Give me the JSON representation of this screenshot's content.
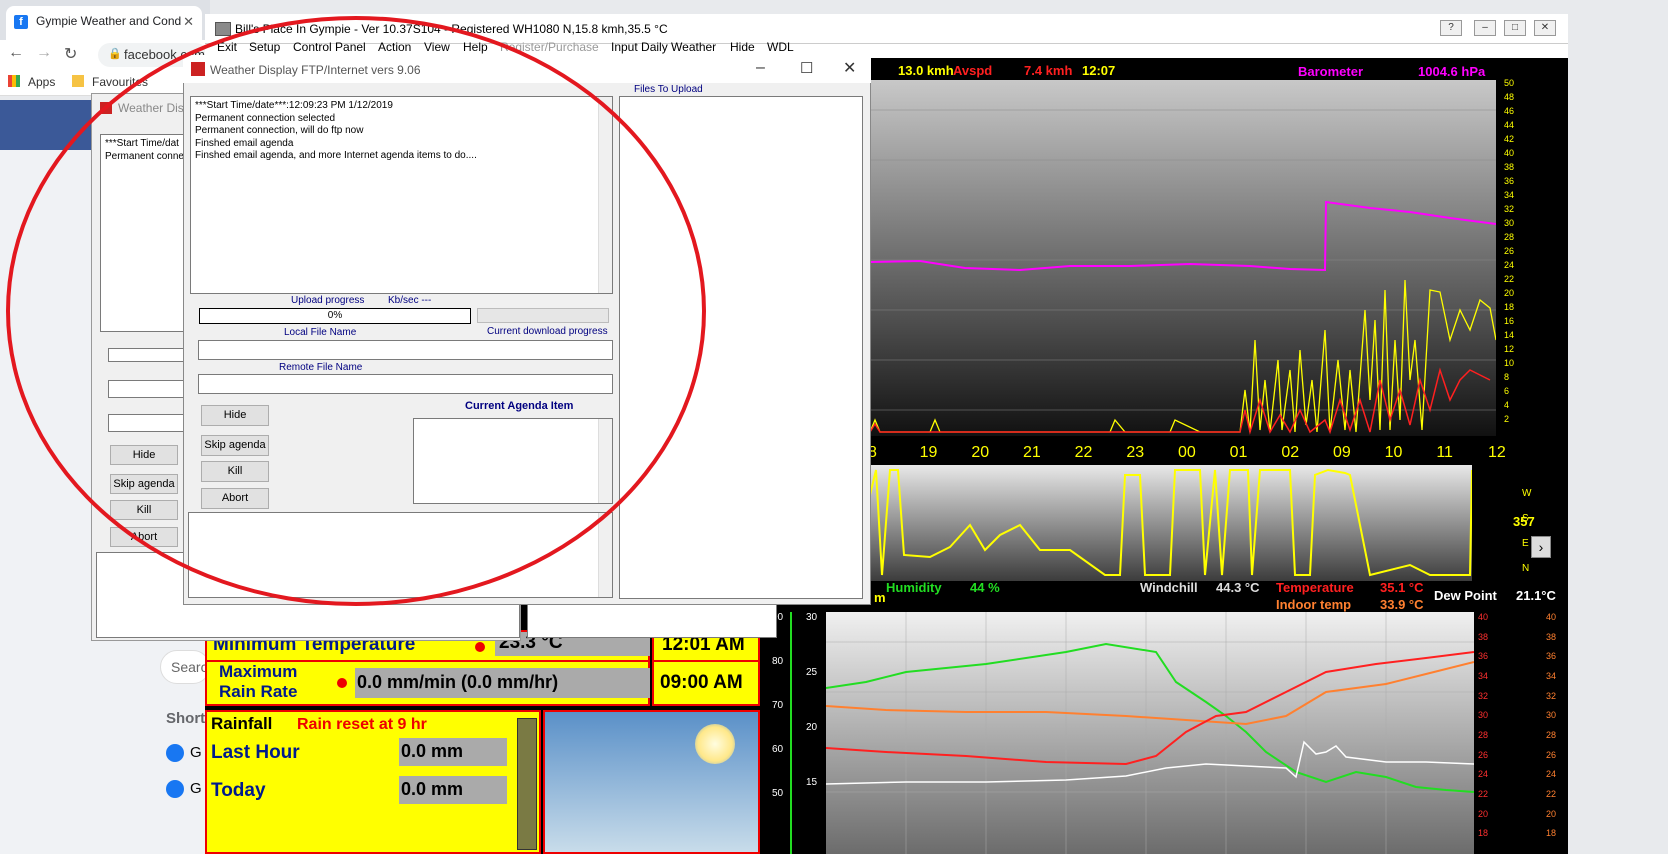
{
  "browser": {
    "tab_title": "Gympie Weather and Cond",
    "tab_favicon": "f",
    "address": "facebook.com",
    "bookmarks": [
      "Apps",
      "Favourites"
    ],
    "fb_search_placeholder": "Searc",
    "shortcuts_label": "Short",
    "shortcut_items": [
      "G",
      "G"
    ]
  },
  "weather_display": {
    "title": "Bill's Place In Gympie - Ver 10.37S104 - Registered    WH1080   N,15.8 kmh,35.5 °C",
    "menu": [
      "Exit",
      "Setup",
      "Control Panel",
      "Action",
      "View",
      "Help",
      "Register/Purchase",
      "Input Daily Weather",
      "Hide",
      "WDL"
    ],
    "header": {
      "wind_value": "13.0 kmh",
      "avspd_label": "Avspd",
      "avspd_value": "7.4 kmh",
      "time": "12:07",
      "barometer_label": "Barometer",
      "barometer_value": "1004.6 hPa"
    },
    "top_y_ticks": [
      "50",
      "48",
      "46",
      "44",
      "42",
      "40",
      "38",
      "36",
      "34",
      "32",
      "30",
      "28",
      "26",
      "24",
      "22",
      "20",
      "18",
      "16",
      "14",
      "12",
      "10",
      "8",
      "6",
      "4",
      "2"
    ],
    "top_x_ticks": [
      "8",
      "19",
      "20",
      "21",
      "22",
      "23",
      "00",
      "01",
      "02",
      "09",
      "10",
      "11",
      "12"
    ],
    "direction_labels": [
      "W",
      "S",
      "E",
      "N"
    ],
    "direction_value": "357",
    "sensor_row": {
      "m_label": "m",
      "humidity_label": "Humidity",
      "humidity_value": "44 %",
      "windchill_label": "Windchill",
      "windchill_value": "44.3 °C",
      "temperature_label": "Temperature",
      "temperature_value": "35.1 °C",
      "indoor_label": "Indoor temp",
      "indoor_value": "33.9 °C",
      "dewpoint_label": "Dew Point",
      "dewpoint_value": "21.1°C"
    },
    "bottom_left_ticks": [
      "90",
      "80",
      "70",
      "60",
      "50"
    ],
    "bottom_inner_ticks": [
      "30",
      "25",
      "20",
      "15"
    ],
    "bottom_right_ticks_a": [
      "40",
      "38",
      "36",
      "34",
      "32",
      "30",
      "28",
      "26",
      "24",
      "22",
      "20",
      "18"
    ],
    "bottom_right_ticks_b": [
      "40",
      "38",
      "36",
      "34",
      "32",
      "30",
      "28",
      "26",
      "24",
      "22",
      "20",
      "18"
    ],
    "panels": {
      "min_temp_label": "Minimum Temperature",
      "min_temp_value": "23.3 °C",
      "min_temp_time": "12:01 AM",
      "max_rain_label_1": "Maximum",
      "max_rain_label_2": "Rain Rate",
      "max_rain_value": "0.0 mm/min (0.0 mm/hr)",
      "max_rain_time": "09:00 AM",
      "rainfall_label": "Rainfall",
      "rain_reset": "Rain reset at 9 hr",
      "last_hour_label": "Last Hour",
      "last_hour_value": "0.0 mm",
      "today_label": "Today",
      "today_value": "0.0 mm"
    }
  },
  "ftp_back": {
    "title": "Weather Disp",
    "log": [
      "***Start Time/dat",
      "Permanent conne"
    ],
    "buttons": [
      "Hide",
      "Skip agenda",
      "Kill",
      "Abort"
    ]
  },
  "ftp": {
    "title": "Weather Display FTP/Internet vers 9.06",
    "log": [
      "***Start Time/date***:12:09:23 PM 1/12/2019",
      "Permanent connection selected",
      "Permanent connection, will do ftp now",
      "Finshed email agenda",
      "Finshed email agenda, and more Internet agenda items to do...."
    ],
    "files_to_upload_label": "Files To Upload",
    "upload_progress_label": "Upload progress",
    "kbsec_label": "Kb/sec ---",
    "progress_text": "0%",
    "progress_value": 0,
    "local_file_label": "Local File Name",
    "current_download_label": "Current download progress",
    "remote_file_label": "Remote File Name",
    "current_agenda_label": "Current Agenda Item",
    "buttons": [
      "Hide",
      "Skip agenda",
      "Kill",
      "Abort"
    ]
  },
  "colors": {
    "ellipse": "#e3181f",
    "yellow": "#ffff00",
    "magenta": "#ff00ff",
    "red": "#ff2020",
    "green": "#22dd22",
    "orange": "#ff8030"
  }
}
